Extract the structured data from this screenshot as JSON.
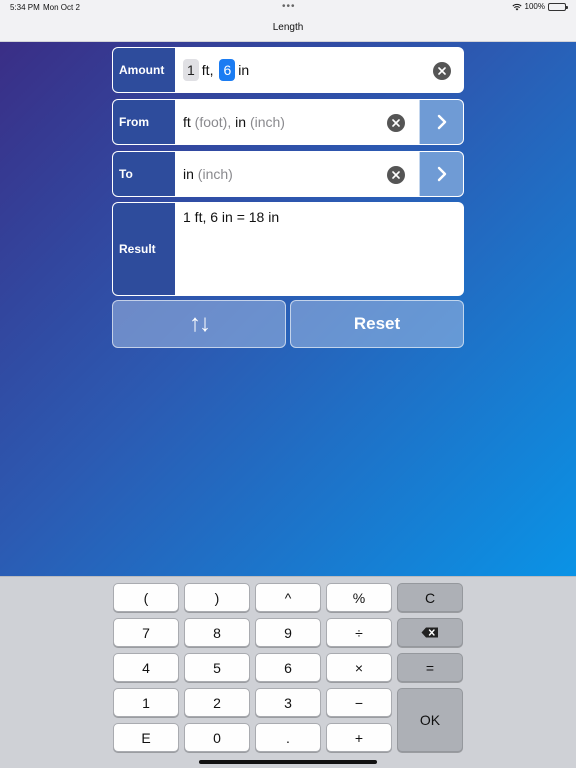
{
  "status": {
    "time": "5:34 PM",
    "date": "Mon Oct 2",
    "battery": "100%",
    "dots": "•••"
  },
  "nav": {
    "title": "Length"
  },
  "amount": {
    "label": "Amount",
    "chip1": "1",
    "unit1": "ft,",
    "chip2": "6",
    "unit2": "in"
  },
  "from": {
    "label": "From",
    "unit1": "ft",
    "name1": "(foot),",
    "unit2": "in",
    "name2": "(inch)"
  },
  "to": {
    "label": "To",
    "unit": "in",
    "name": "(inch)"
  },
  "result": {
    "label": "Result",
    "value": "1 ft, 6 in = 18 in"
  },
  "actions": {
    "swap_label": "↑↓",
    "reset_label": "Reset"
  },
  "keypad": {
    "row1": [
      "(",
      ")",
      "^",
      "%",
      "C"
    ],
    "row2": [
      "7",
      "8",
      "9",
      "÷"
    ],
    "row3": [
      "4",
      "5",
      "6",
      "×",
      "="
    ],
    "row4": [
      "1",
      "2",
      "3",
      "−"
    ],
    "row5": [
      "E",
      "0",
      ".",
      "+"
    ],
    "ok": "OK"
  },
  "colors": {
    "accent": "#1b7cf2",
    "label_bg": "#2e4c9c",
    "arrow_bg": "#6f9bd5"
  }
}
